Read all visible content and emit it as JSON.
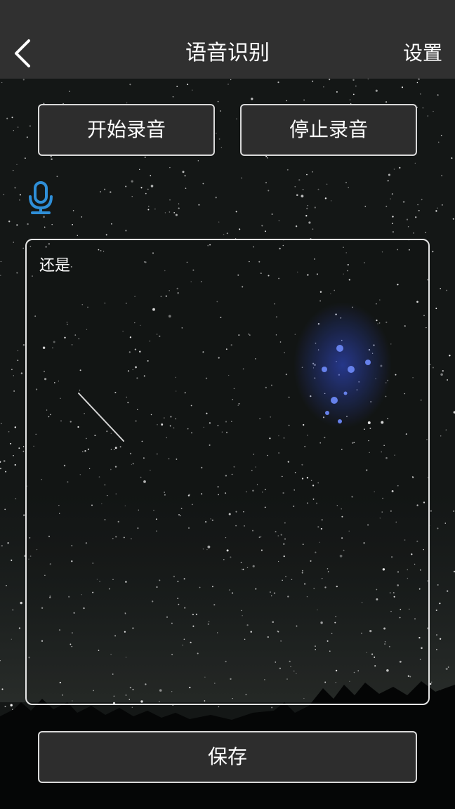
{
  "app_bar": {
    "title": "语音识别",
    "settings_label": "设置"
  },
  "controls": {
    "start_label": "开始录音",
    "stop_label": "停止录音",
    "save_label": "保存"
  },
  "recognition": {
    "text": "还是"
  },
  "icons": {
    "back": "chevron-left-icon",
    "mic": "microphone-icon"
  },
  "colors": {
    "bar_background": "#303030",
    "mic_accent": "#2f8fd8",
    "text": "#ffffff",
    "button_border": "#d9d9d9"
  }
}
